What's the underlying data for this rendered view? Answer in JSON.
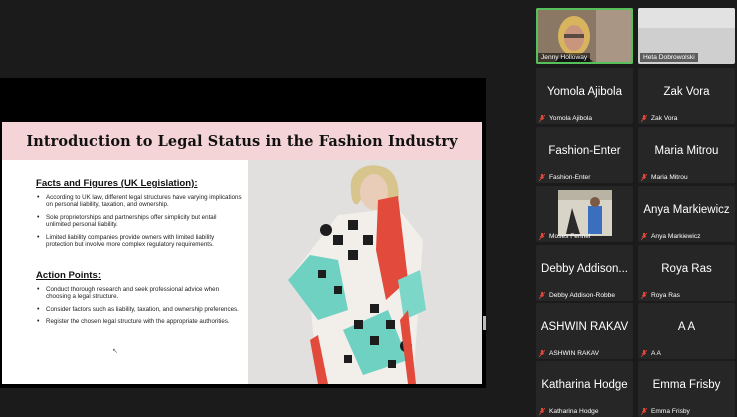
{
  "slide": {
    "title": "Introduction to Legal Status in the Fashion Industry",
    "section1": {
      "heading": "Facts and Figures (UK Legislation):",
      "bullets": [
        "According to UK law, different legal structures have varying implications on personal liability, taxation, and ownership.",
        "Sole proprietorships and partnerships offer simplicity but entail unlimited personal liability.",
        "Limited liability companies provide owners with limited liability protection but involve more complex regulatory requirements."
      ]
    },
    "section2": {
      "heading": "Action Points:",
      "bullets": [
        "Conduct thorough research and seek professional advice when choosing a legal structure.",
        "Consider factors such as liability, taxation, and ownership preferences.",
        "Register the chosen legal structure with the appropriate authorities."
      ]
    }
  },
  "participants": [
    {
      "name": "Jenny Holloway",
      "label": "Jenny Holloway",
      "video": true,
      "active": true,
      "muted": false
    },
    {
      "name": "Heta Dobrowolski",
      "label": "Heta Dobrowolski",
      "video": true,
      "active": false,
      "muted": false
    },
    {
      "name": "Yomola Ajibola",
      "label": "Yomola Ajibola",
      "video": false,
      "muted": true
    },
    {
      "name": "Zak Vora",
      "label": "Zak Vora",
      "video": false,
      "muted": true
    },
    {
      "name": "Fashion-Enter",
      "label": "Fashion-Enter",
      "video": false,
      "muted": true
    },
    {
      "name": "Maria Mitrou",
      "label": "Maria Mitrou",
      "video": false,
      "muted": true
    },
    {
      "name": "Moses Fennel",
      "label": "Moses Fennel",
      "video": true,
      "muted": true
    },
    {
      "name": "Anya Markiewicz",
      "label": "Anya Markiewicz",
      "video": false,
      "muted": true
    },
    {
      "name": "Debby Addison...",
      "label": "Debby Addison-Robbe",
      "video": false,
      "muted": true
    },
    {
      "name": "Roya Ras",
      "label": "Roya Ras",
      "video": false,
      "muted": true
    },
    {
      "name": "ASHWIN RAKAV",
      "label": "ASHWIN RAKAV",
      "video": false,
      "muted": true
    },
    {
      "name": "A A",
      "label": "A A",
      "video": false,
      "muted": true
    },
    {
      "name": "Katharina Hodge",
      "label": "Katharina Hodge",
      "video": false,
      "muted": true
    },
    {
      "name": "Emma Frisby",
      "label": "Emma Frisby",
      "video": false,
      "muted": true
    }
  ],
  "colors": {
    "active_border": "#56c15b",
    "mute": "#e0473b",
    "title_bar": "#f4d4d6"
  }
}
